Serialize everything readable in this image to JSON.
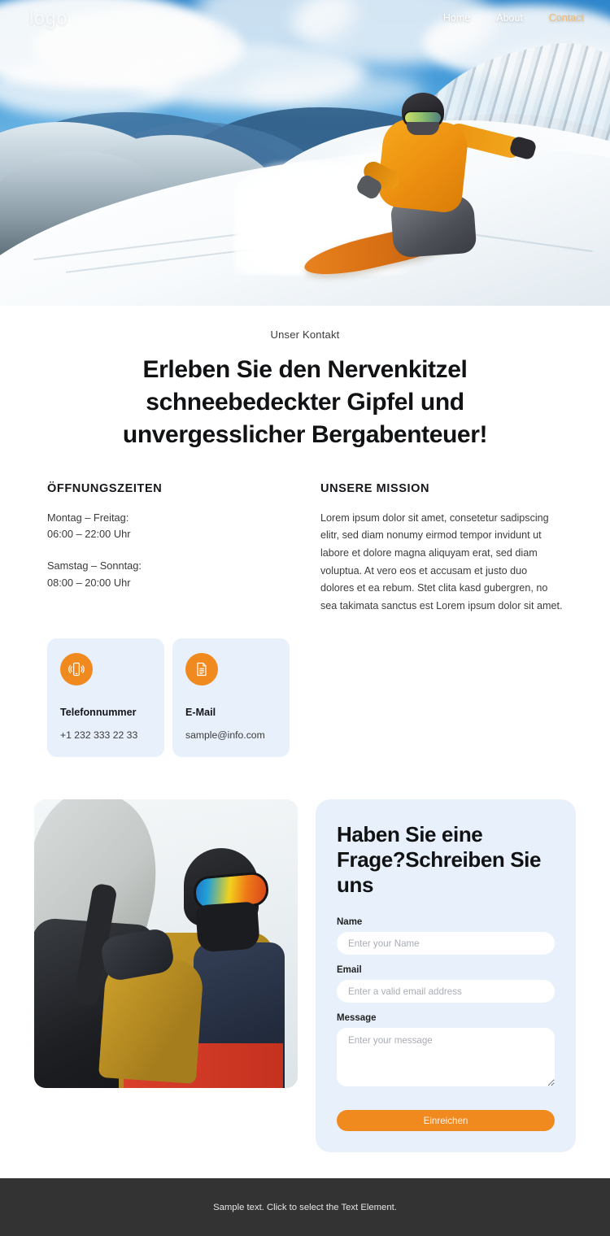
{
  "nav": {
    "logo": "logo",
    "links": [
      {
        "label": "Home",
        "accent": false
      },
      {
        "label": "About",
        "accent": false
      },
      {
        "label": "Contact",
        "accent": true
      }
    ]
  },
  "hero": {
    "image_alt": "Snowboarder carving through fresh powder on a snow-covered mountain slope"
  },
  "intro": {
    "eyebrow": "Unser Kontakt",
    "headline": "Erleben Sie den Nervenkitzel schneebedeckter Gipfel und unvergesslicher Bergabenteuer!"
  },
  "hours": {
    "title": "ÖFFNUNGSZEITEN",
    "weekday_days": "Montag – Freitag:",
    "weekday_time": "06:00 – 22:00 Uhr",
    "weekend_days": "Samstag – Sonntag:",
    "weekend_time": "08:00 – 20:00 Uhr"
  },
  "mission": {
    "title": "UNSERE MISSION",
    "body": "Lorem ipsum dolor sit amet, consetetur sadipscing elitr, sed diam nonumy eirmod tempor invidunt ut labore et dolore magna aliquyam erat, sed diam voluptua. At vero eos et accusam et justo duo dolores et ea rebum. Stet clita kasd gubergren, no sea takimata sanctus est Lorem ipsum dolor sit amet."
  },
  "contact_cards": [
    {
      "icon": "mobile-phone-icon",
      "title": "Telefonnummer",
      "value": "+1 232 333 22 33"
    },
    {
      "icon": "document-icon",
      "title": "E-Mail",
      "value": "sample@info.com"
    }
  ],
  "photo": {
    "image_alt": "Snowboarder with mirrored goggles and face mask carrying a board"
  },
  "form": {
    "title": "Haben Sie eine Frage?Schreiben Sie uns",
    "name_label": "Name",
    "name_placeholder": "Enter your Name",
    "name_value": "",
    "email_label": "Email",
    "email_placeholder": "Enter a valid email address",
    "email_value": "",
    "message_label": "Message",
    "message_placeholder": "Enter your message",
    "message_value": "",
    "submit_label": "Einreichen"
  },
  "footer": {
    "text": "Sample text. Click to select the Text Element."
  },
  "colors": {
    "accent_orange": "#f18a1e",
    "card_blue": "#e8f0fb",
    "nav_accent": "#f0bd78",
    "footer_dark": "#333333",
    "heading": "#111214"
  }
}
